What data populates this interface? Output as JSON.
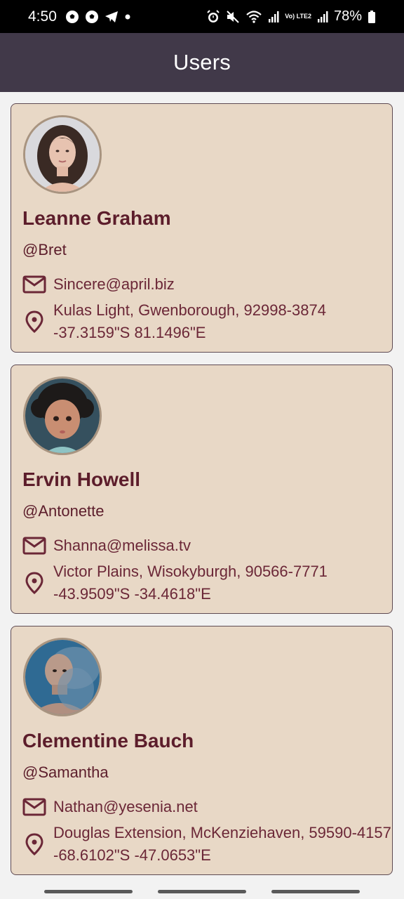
{
  "status_bar": {
    "time": "4:50",
    "battery": "78%",
    "left_icons": [
      "soccer-ball-icon",
      "soccer-ball-icon",
      "telegram-icon",
      "dot-icon"
    ],
    "right_icons": [
      "alarm-icon",
      "mute-icon",
      "wifi-icon",
      "signal-icon",
      "volte-icon",
      "signal-icon",
      "battery-icon"
    ],
    "volte_label": "Vo) LTE2"
  },
  "app_bar": {
    "title": "Users"
  },
  "users": [
    {
      "name": "Leanne Graham",
      "username": "@Bret",
      "email": "Sincere@april.biz",
      "address": "Kulas Light, Gwenborough, 92998-3874",
      "geo": "-37.3159\"S 81.1496\"E",
      "avatar": "woman-portrait"
    },
    {
      "name": "Ervin Howell",
      "username": "@Antonette",
      "email": "Shanna@melissa.tv",
      "address": "Victor Plains, Wisokyburgh, 90566-7771",
      "geo": "-43.9509\"S -34.4618\"E",
      "avatar": "child-portrait"
    },
    {
      "name": "Clementine Bauch",
      "username": "@Samantha",
      "email": "Nathan@yesenia.net",
      "address": "Douglas Extension, McKenziehaven, 59590-4157",
      "geo": "-68.6102\"S -47.0653\"E",
      "avatar": "man-portrait"
    }
  ],
  "colors": {
    "app_bar": "#413949",
    "card_background": "#e8d8c6",
    "card_border": "#5e4a52",
    "text_primary": "#5c1d2b",
    "background": "#f2f2f2"
  }
}
